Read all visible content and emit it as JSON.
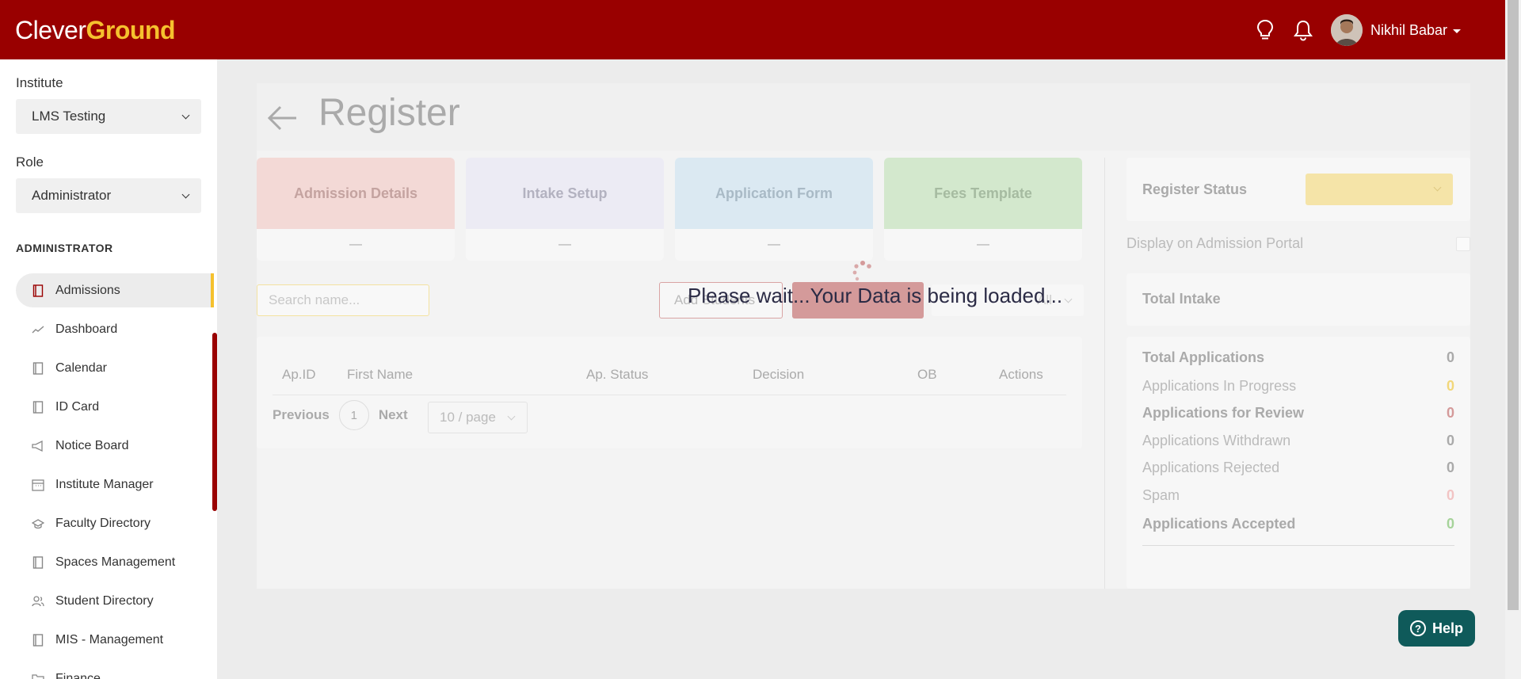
{
  "brand": {
    "name_part1": "Clever",
    "name_part2": "Ground"
  },
  "topbar": {
    "user_name": "Nikhil Babar",
    "icons": [
      "lightbulb-icon",
      "bell-icon"
    ]
  },
  "sidebar": {
    "institute_label": "Institute",
    "institute_value": "LMS Testing",
    "role_label": "Role",
    "role_value": "Administrator",
    "section_title": "ADMINISTRATOR",
    "items": [
      {
        "label": "Admissions",
        "icon": "book-icon",
        "active": true
      },
      {
        "label": "Dashboard",
        "icon": "chart-line-icon"
      },
      {
        "label": "Calendar",
        "icon": "book-icon"
      },
      {
        "label": "ID Card",
        "icon": "book-icon"
      },
      {
        "label": "Notice Board",
        "icon": "megaphone-icon"
      },
      {
        "label": "Institute Manager",
        "icon": "calendar-grid-icon"
      },
      {
        "label": "Faculty Directory",
        "icon": "graduation-cap-icon"
      },
      {
        "label": "Spaces Management",
        "icon": "book-icon"
      },
      {
        "label": "Student Directory",
        "icon": "users-icon"
      },
      {
        "label": "MIS - Management",
        "icon": "book-icon"
      },
      {
        "label": "Finance",
        "icon": "folder-icon"
      }
    ]
  },
  "main": {
    "title": "Register",
    "cards": [
      {
        "title": "Admission Details",
        "value": "—",
        "header_bg": "#f3d9d6",
        "title_color": "#c4a3a0"
      },
      {
        "title": "Intake Setup",
        "value": "—",
        "header_bg": "#ecebf4",
        "title_color": "#b3b2c0"
      },
      {
        "title": "Application Form",
        "value": "—",
        "header_bg": "#dbe9f2",
        "title_color": "#a9bac6"
      },
      {
        "title": "Fees Template",
        "value": "—",
        "header_bg": "#d3e8cd",
        "title_color": "#a6bba1"
      }
    ],
    "search_placeholder": "Search name...",
    "outline_button": "Add Students",
    "filter_value": "All",
    "table": {
      "headers": [
        "Ap.ID",
        "First Name",
        "Ap. Status",
        "Decision",
        "OB",
        "Actions"
      ],
      "pagination": {
        "previous": "Previous",
        "page": "1",
        "next": "Next",
        "per_page": "10 / page"
      }
    }
  },
  "right_panel": {
    "register_status_label": "Register Status",
    "portal_label": "Display on Admission Portal",
    "total_intake_label": "Total Intake",
    "applications": [
      {
        "label": "Total Applications",
        "count": "0",
        "bold": true,
        "color": "#aaaaaa"
      },
      {
        "label": "Applications In Progress",
        "count": "0",
        "bold": false,
        "color": "#f2d77a"
      },
      {
        "label": "Applications for Review",
        "count": "0",
        "bold": true,
        "color": "#d49a9a"
      },
      {
        "label": "Applications Withdrawn",
        "count": "0",
        "bold": false,
        "color": "#aaaaaa"
      },
      {
        "label": "Applications Rejected",
        "count": "0",
        "bold": false,
        "color": "#aaaaaa"
      },
      {
        "label": "Spam",
        "count": "0",
        "bold": false,
        "color": "#f2c4c4"
      },
      {
        "label": "Applications Accepted",
        "count": "0",
        "bold": true,
        "color": "#a6d39a"
      }
    ]
  },
  "loading_text": "Please wait...Your Data is being loaded...",
  "help_label": "Help",
  "colors": {
    "brand": "#990000",
    "accent": "#f5c12e",
    "help": "#0f5a5a"
  }
}
